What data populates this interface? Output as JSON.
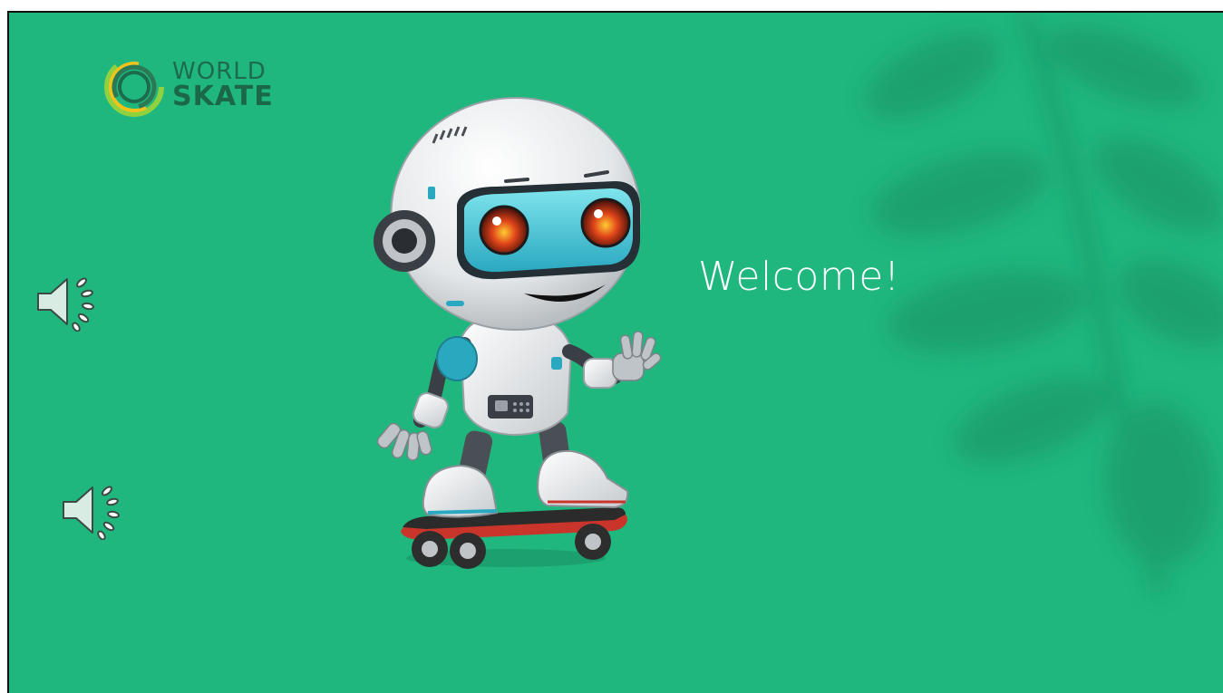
{
  "slide": {
    "background_color": "#20b77e",
    "welcome_text": "Welcome!"
  },
  "logo": {
    "line1": "WORLD",
    "line2": "SKATE"
  },
  "audio": [
    {
      "icon": "speaker-icon"
    },
    {
      "icon": "speaker-icon"
    }
  ]
}
